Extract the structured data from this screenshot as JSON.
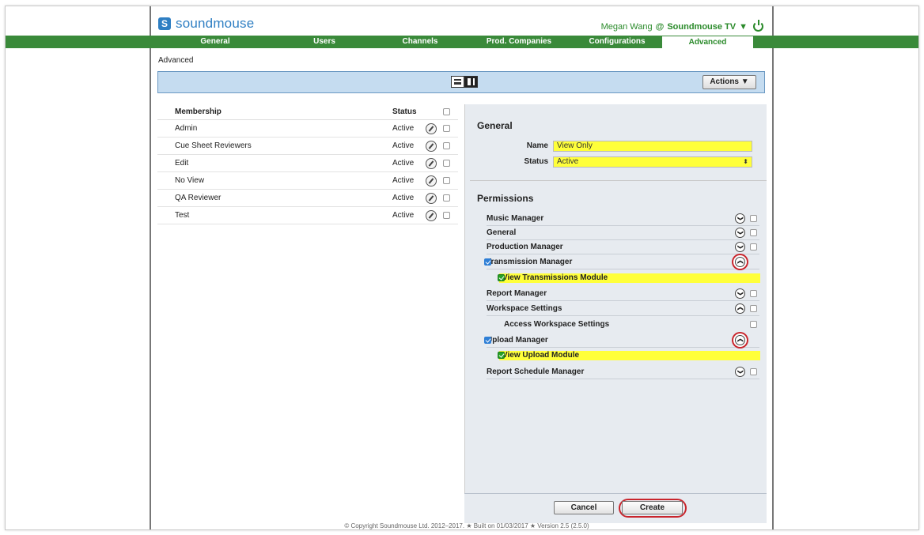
{
  "brand": {
    "name": "soundmouse"
  },
  "user": {
    "name": "Megan Wang",
    "at": "@",
    "org": "Soundmouse TV",
    "menu_arrow": "▼"
  },
  "nav": [
    {
      "label": "General"
    },
    {
      "label": "Users"
    },
    {
      "label": "Channels"
    },
    {
      "label": "Prod. Companies"
    },
    {
      "label": "Configurations"
    },
    {
      "label": "Advanced"
    }
  ],
  "breadcrumb": "Advanced",
  "toolbar": {
    "actions_label": "Actions ▼"
  },
  "membership": {
    "col_membership": "Membership",
    "col_status": "Status",
    "rows": [
      {
        "name": "Admin",
        "status": "Active"
      },
      {
        "name": "Cue Sheet Reviewers",
        "status": "Active"
      },
      {
        "name": "Edit",
        "status": "Active"
      },
      {
        "name": "No View",
        "status": "Active"
      },
      {
        "name": "QA Reviewer",
        "status": "Active"
      },
      {
        "name": "Test",
        "status": "Active"
      }
    ]
  },
  "general": {
    "title": "General",
    "name_label": "Name",
    "name_value": "View Only",
    "status_label": "Status",
    "status_value": "Active"
  },
  "permissions": {
    "title": "Permissions",
    "items": [
      {
        "label": "Music Manager"
      },
      {
        "label": "General"
      },
      {
        "label": "Production Manager"
      },
      {
        "label": "Transmission Manager"
      },
      {
        "label": "View Transmissions Module"
      },
      {
        "label": "Report Manager"
      },
      {
        "label": "Workspace Settings"
      },
      {
        "label": "Access Workspace Settings"
      },
      {
        "label": "Upload Manager"
      },
      {
        "label": "View Upload Module"
      },
      {
        "label": "Report Schedule Manager"
      }
    ]
  },
  "buttons": {
    "cancel": "Cancel",
    "create": "Create"
  },
  "footer": {
    "copyright": "© Copyright Soundmouse Ltd. 2012–2017. ★ Built on 01/03/2017 ★ Version 2.5 (2.5.0)"
  }
}
